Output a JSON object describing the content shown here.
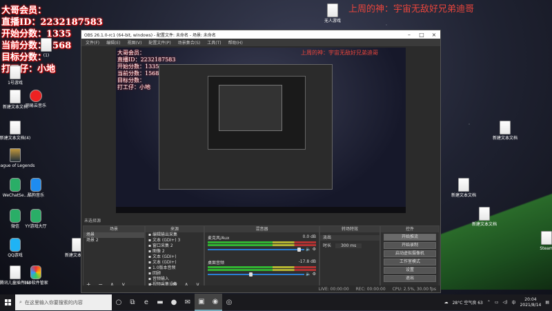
{
  "overlay": {
    "lines": [
      {
        "label": "大哥会员：",
        "value": ""
      },
      {
        "label": "直播ID：",
        "value": "2232187583"
      },
      {
        "label": "开始分数：",
        "value": "1335"
      },
      {
        "label": "当前分数：",
        "value": "1568"
      },
      {
        "label": "目标分数：",
        "value": ""
      },
      {
        "label": "打工仔：",
        "value": "小地"
      }
    ],
    "headline": "上周的神：宇宙无敌好兄弟迪哥"
  },
  "desktop_icons": [
    {
      "label": "1号游戏",
      "kind": "doc"
    },
    {
      "label": "新建文本文档",
      "kind": "doc"
    },
    {
      "label": "网易云音乐",
      "kind": "red"
    },
    {
      "label": "新建文本文档(4)",
      "kind": "doc"
    },
    {
      "label": "League of Legends",
      "kind": "lol"
    },
    {
      "label": "WeChatSe...",
      "kind": "wc"
    },
    {
      "label": "酷狗音乐",
      "kind": "kuwo"
    },
    {
      "label": "微信",
      "kind": "wc"
    },
    {
      "label": "YY游戏大厅",
      "kind": "wc"
    },
    {
      "label": "QQ游戏",
      "kind": "qq"
    },
    {
      "label": "腾讯儿童插件(1)",
      "kind": "doc"
    },
    {
      "label": "360软件管家",
      "kind": "pin"
    },
    {
      "label": "新建文本文档",
      "kind": "doc"
    },
    {
      "label": "新建文本文档",
      "kind": "doc"
    },
    {
      "label": "新建文本文档",
      "kind": "doc"
    },
    {
      "label": "新建文本文档",
      "kind": "doc"
    },
    {
      "label": "Steam",
      "kind": "doc"
    },
    {
      "label": "(1)",
      "kind": "doc"
    },
    {
      "label": "无人游戏",
      "kind": "doc"
    }
  ],
  "obs": {
    "title": "OBS 26.1.0-rc1 (64-bit, windows) - 配置文件: 未命名 - 场景: 未命名",
    "menu": [
      "文件(F)",
      "编辑(E)",
      "视图(V)",
      "配置文件(P)",
      "场景集合(S)",
      "工具(T)",
      "帮助(H)"
    ],
    "no_source": "未选择源",
    "docks": {
      "scenes": "场景",
      "sources": "来源",
      "mixer": "混音器",
      "transitions": "转场特效",
      "controls": "控件"
    },
    "scenes": [
      "场景",
      "场景 2"
    ],
    "sources": [
      "编辑输出采集",
      "文本 (GDI+) 3",
      "窗口采集 2",
      "图像 2",
      "文本 (GDI+)",
      "文本 (GDI+)",
      "1.0版本音频",
      "回顾",
      "音频输入",
      "视频采集设备"
    ],
    "mixer": [
      {
        "name": "麦克风/Aux",
        "db": "0.0 dB"
      },
      {
        "name": "桌面音频",
        "db": "-17.8 dB"
      }
    ],
    "transition": {
      "type": "淡出",
      "duration_label": "时长",
      "duration": "300 ms"
    },
    "controls": [
      "开始推流",
      "开始录制",
      "启动虚拟摄像机",
      "工作室模式",
      "设置",
      "退出"
    ],
    "status": [
      "LIVE: 00:00:00",
      "REC: 00:00:00",
      "CPU: 2.5%, 30.00 fps"
    ]
  },
  "taskbar": {
    "search_placeholder": "在这里输入你要搜索的内容",
    "weather": "28°C 空气良 63",
    "time": "20:04",
    "date": "2021/8/14",
    "ime": "中"
  }
}
